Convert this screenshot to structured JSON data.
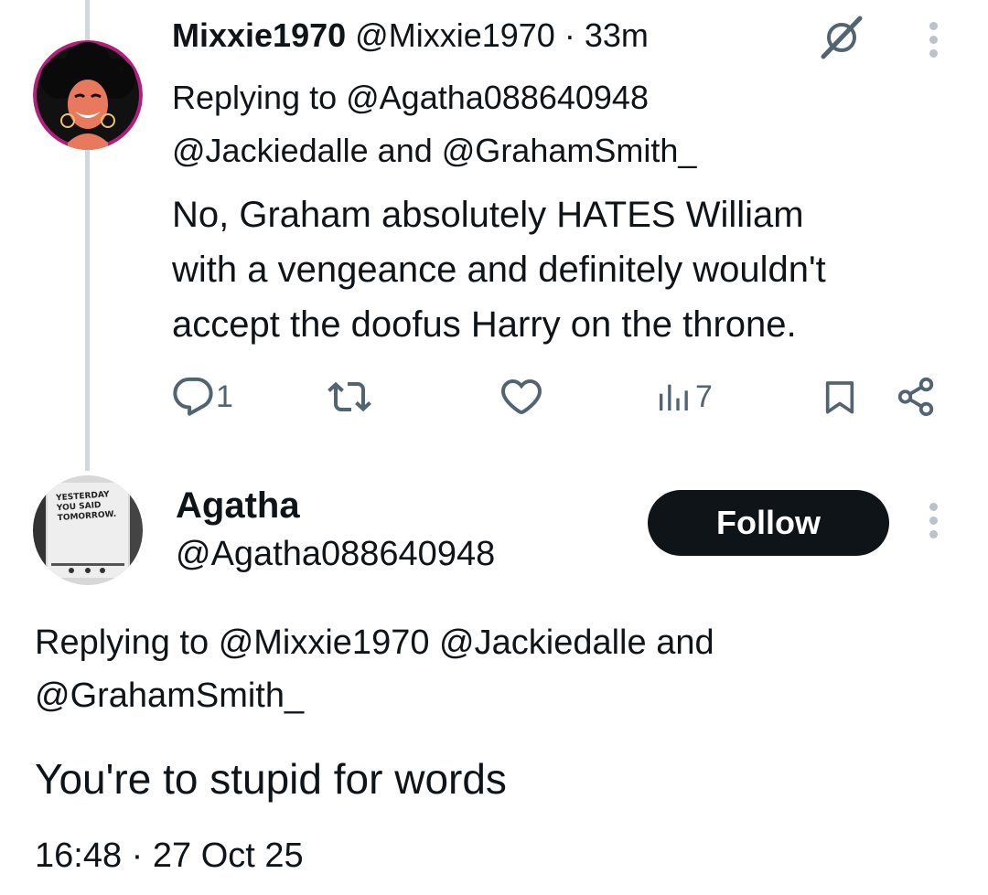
{
  "reply_tweet": {
    "display_name": "Mixxie1970",
    "handle": "@Mixxie1970",
    "separator": "·",
    "time_ago": "33m",
    "replying_prefix": "Replying to",
    "replying_to_1": "@Agatha088640948",
    "replying_to_2": "@Jackiedalle",
    "replying_and": "and",
    "replying_to_3": "@GrahamSmith_",
    "text_line1": "No, Graham absolutely HATES William",
    "text_line2": "with a vengeance and definitely wouldn't",
    "text_line3": "accept the doofus Harry on the throne.",
    "reply_count": "1",
    "view_count": "7",
    "icons": [
      "grok-icon",
      "more-icon",
      "reply-icon",
      "retweet-icon",
      "like-icon",
      "views-icon",
      "bookmark-icon",
      "share-icon"
    ]
  },
  "main_tweet": {
    "display_name": "Agatha",
    "handle": "@Agatha088640948",
    "follow_label": "Follow",
    "replying_prefix": "Replying to",
    "replying_to_1": "@Mixxie1970",
    "replying_to_2": "@Jackiedalle",
    "replying_and": "and",
    "replying_to_3": "@GrahamSmith_",
    "text": "You're to stupid for words",
    "time": "16:48",
    "separator": "·",
    "date": "27 Oct 25",
    "avatar_text": [
      "YESTERDAY",
      "YOU SAID",
      "TOMORROW."
    ]
  },
  "colors": {
    "text": "#0f1419",
    "secondary": "#536471",
    "thread_line": "#cfd9de",
    "button_bg": "#0f1419",
    "button_text": "#ffffff"
  }
}
